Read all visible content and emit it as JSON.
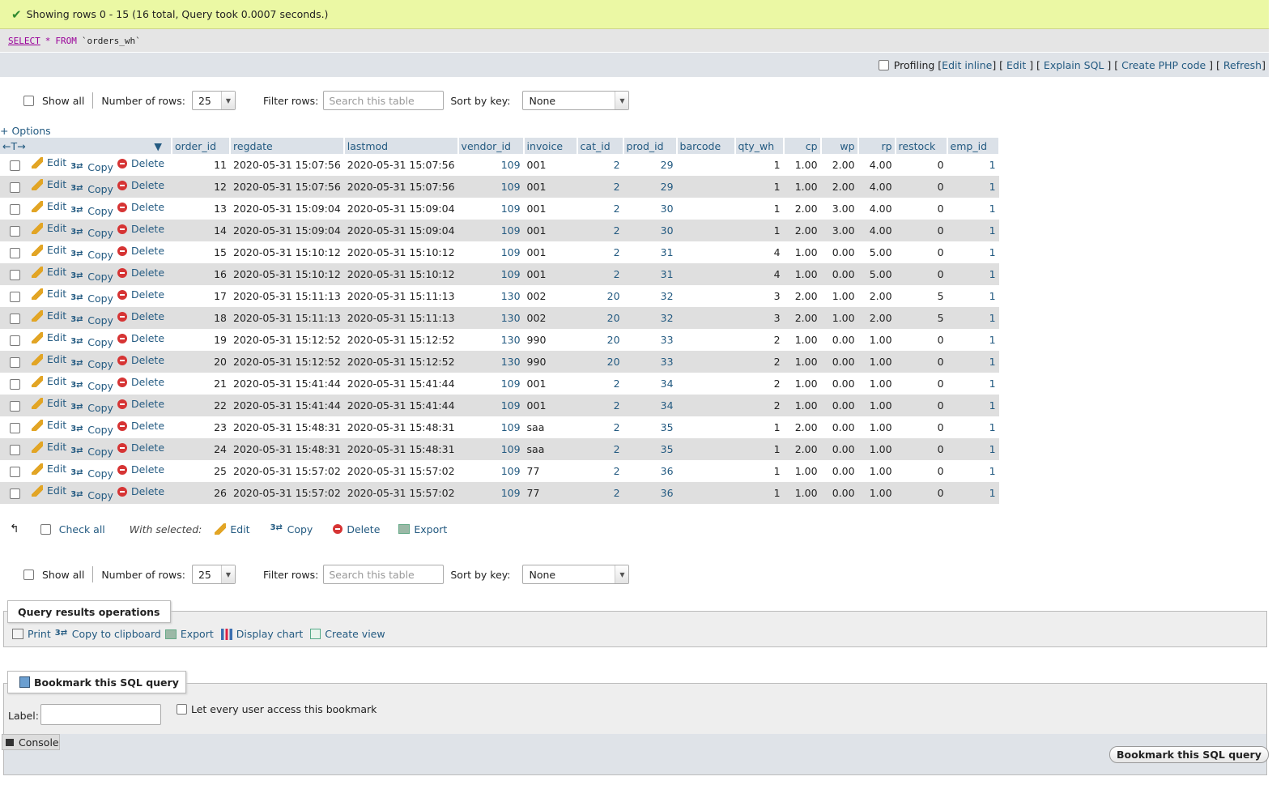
{
  "message": "Showing rows 0 - 15 (16 total, Query took 0.0007 seconds.)",
  "sql": {
    "select": "SELECT",
    "star": "*",
    "from": "FROM",
    "table": "`orders_wh`"
  },
  "profiling": {
    "label": "Profiling",
    "edit_inline": "Edit inline",
    "edit": "Edit",
    "explain": "Explain SQL",
    "create_php": "Create PHP code",
    "refresh": "Refresh"
  },
  "nav": {
    "show_all": "Show all",
    "rows_label": "Number of rows:",
    "rows_value": "25",
    "filter_label": "Filter rows:",
    "filter_placeholder": "Search this table",
    "sort_label": "Sort by key:",
    "sort_value": "None"
  },
  "options_label": "+ Options",
  "columns": [
    "order_id",
    "regdate",
    "lastmod",
    "vendor_id",
    "invoice",
    "cat_id",
    "prod_id",
    "barcode",
    "qty_wh",
    "cp",
    "wp",
    "rp",
    "restock",
    "emp_id"
  ],
  "actions": {
    "edit": "Edit",
    "copy": "Copy",
    "delete": "Delete"
  },
  "rows": [
    [
      "11",
      "2020-05-31 15:07:56",
      "2020-05-31 15:07:56",
      "109",
      "001",
      "2",
      "29",
      "",
      "1",
      "1.00",
      "2.00",
      "4.00",
      "0",
      "1"
    ],
    [
      "12",
      "2020-05-31 15:07:56",
      "2020-05-31 15:07:56",
      "109",
      "001",
      "2",
      "29",
      "",
      "1",
      "1.00",
      "2.00",
      "4.00",
      "0",
      "1"
    ],
    [
      "13",
      "2020-05-31 15:09:04",
      "2020-05-31 15:09:04",
      "109",
      "001",
      "2",
      "30",
      "",
      "1",
      "2.00",
      "3.00",
      "4.00",
      "0",
      "1"
    ],
    [
      "14",
      "2020-05-31 15:09:04",
      "2020-05-31 15:09:04",
      "109",
      "001",
      "2",
      "30",
      "",
      "1",
      "2.00",
      "3.00",
      "4.00",
      "0",
      "1"
    ],
    [
      "15",
      "2020-05-31 15:10:12",
      "2020-05-31 15:10:12",
      "109",
      "001",
      "2",
      "31",
      "",
      "4",
      "1.00",
      "0.00",
      "5.00",
      "0",
      "1"
    ],
    [
      "16",
      "2020-05-31 15:10:12",
      "2020-05-31 15:10:12",
      "109",
      "001",
      "2",
      "31",
      "",
      "4",
      "1.00",
      "0.00",
      "5.00",
      "0",
      "1"
    ],
    [
      "17",
      "2020-05-31 15:11:13",
      "2020-05-31 15:11:13",
      "130",
      "002",
      "20",
      "32",
      "",
      "3",
      "2.00",
      "1.00",
      "2.00",
      "5",
      "1"
    ],
    [
      "18",
      "2020-05-31 15:11:13",
      "2020-05-31 15:11:13",
      "130",
      "002",
      "20",
      "32",
      "",
      "3",
      "2.00",
      "1.00",
      "2.00",
      "5",
      "1"
    ],
    [
      "19",
      "2020-05-31 15:12:52",
      "2020-05-31 15:12:52",
      "130",
      "990",
      "20",
      "33",
      "",
      "2",
      "1.00",
      "0.00",
      "1.00",
      "0",
      "1"
    ],
    [
      "20",
      "2020-05-31 15:12:52",
      "2020-05-31 15:12:52",
      "130",
      "990",
      "20",
      "33",
      "",
      "2",
      "1.00",
      "0.00",
      "1.00",
      "0",
      "1"
    ],
    [
      "21",
      "2020-05-31 15:41:44",
      "2020-05-31 15:41:44",
      "109",
      "001",
      "2",
      "34",
      "",
      "2",
      "1.00",
      "0.00",
      "1.00",
      "0",
      "1"
    ],
    [
      "22",
      "2020-05-31 15:41:44",
      "2020-05-31 15:41:44",
      "109",
      "001",
      "2",
      "34",
      "",
      "2",
      "1.00",
      "0.00",
      "1.00",
      "0",
      "1"
    ],
    [
      "23",
      "2020-05-31 15:48:31",
      "2020-05-31 15:48:31",
      "109",
      "saa",
      "2",
      "35",
      "",
      "1",
      "2.00",
      "0.00",
      "1.00",
      "0",
      "1"
    ],
    [
      "24",
      "2020-05-31 15:48:31",
      "2020-05-31 15:48:31",
      "109",
      "saa",
      "2",
      "35",
      "",
      "1",
      "2.00",
      "0.00",
      "1.00",
      "0",
      "1"
    ],
    [
      "25",
      "2020-05-31 15:57:02",
      "2020-05-31 15:57:02",
      "109",
      "77",
      "2",
      "36",
      "",
      "1",
      "1.00",
      "0.00",
      "1.00",
      "0",
      "1"
    ],
    [
      "26",
      "2020-05-31 15:57:02",
      "2020-05-31 15:57:02",
      "109",
      "77",
      "2",
      "36",
      "",
      "1",
      "1.00",
      "0.00",
      "1.00",
      "0",
      "1"
    ]
  ],
  "bulk": {
    "check_all": "Check all",
    "with_selected": "With selected:",
    "edit": "Edit",
    "copy": "Copy",
    "delete": "Delete",
    "export": "Export"
  },
  "ops": {
    "legend": "Query results operations",
    "print": "Print",
    "clipboard": "Copy to clipboard",
    "export": "Export",
    "chart": "Display chart",
    "view": "Create view"
  },
  "bookmark": {
    "legend": "Bookmark this SQL query",
    "label": "Label:",
    "share": "Let every user access this bookmark",
    "button": "Bookmark this SQL query"
  },
  "console": "Console"
}
